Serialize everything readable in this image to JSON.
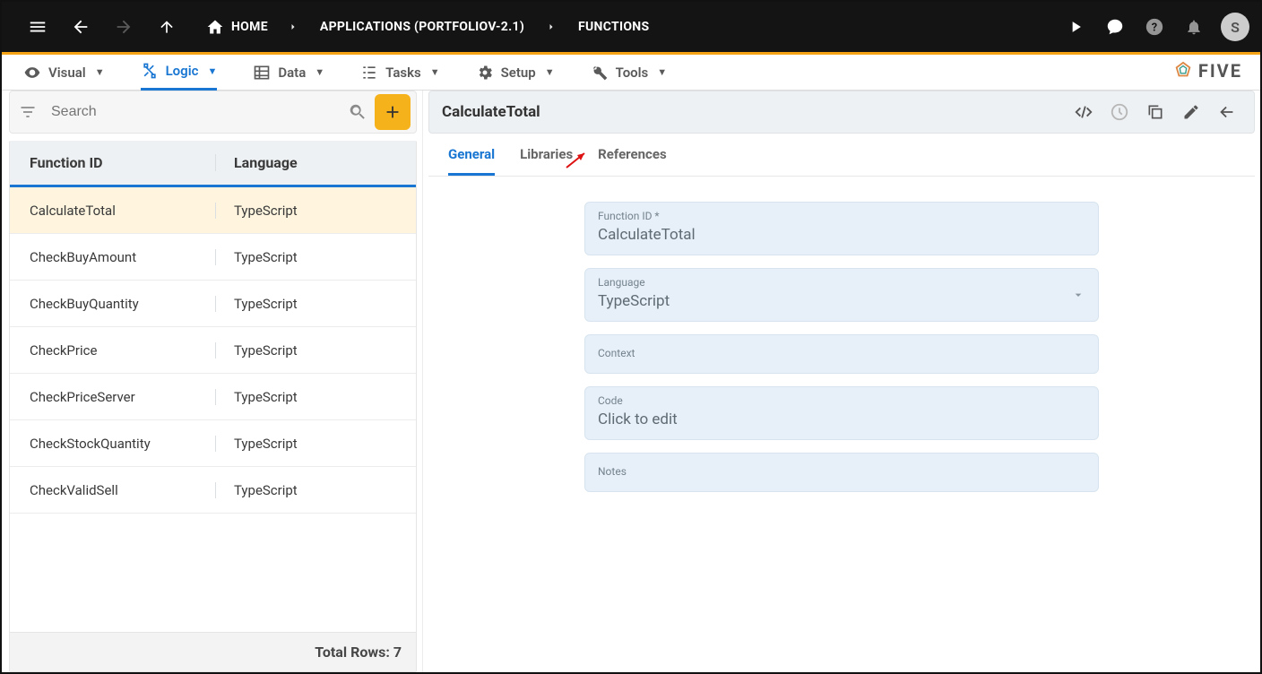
{
  "topbar": {
    "home": "HOME",
    "crumb_apps": "APPLICATIONS (PORTFOLIOV-2.1)",
    "crumb_funcs": "FUNCTIONS",
    "avatar": "S"
  },
  "nav": {
    "visual": "Visual",
    "logic": "Logic",
    "data": "Data",
    "tasks": "Tasks",
    "setup": "Setup",
    "tools": "Tools",
    "brand": "FIVE"
  },
  "search": {
    "placeholder": "Search"
  },
  "list": {
    "col_a": "Function ID",
    "col_b": "Language",
    "rows": [
      {
        "id": "CalculateTotal",
        "lang": "TypeScript",
        "selected": true
      },
      {
        "id": "CheckBuyAmount",
        "lang": "TypeScript"
      },
      {
        "id": "CheckBuyQuantity",
        "lang": "TypeScript"
      },
      {
        "id": "CheckPrice",
        "lang": "TypeScript"
      },
      {
        "id": "CheckPriceServer",
        "lang": "TypeScript"
      },
      {
        "id": "CheckStockQuantity",
        "lang": "TypeScript"
      },
      {
        "id": "CheckValidSell",
        "lang": "TypeScript"
      }
    ],
    "footer": "Total Rows: 7"
  },
  "detail": {
    "title": "CalculateTotal",
    "tabs": {
      "general": "General",
      "libraries": "Libraries",
      "references": "References"
    },
    "fields": {
      "function_id_label": "Function ID *",
      "function_id_value": "CalculateTotal",
      "language_label": "Language",
      "language_value": "TypeScript",
      "context_label": "Context",
      "code_label": "Code",
      "code_value": "Click to edit",
      "notes_label": "Notes"
    }
  }
}
